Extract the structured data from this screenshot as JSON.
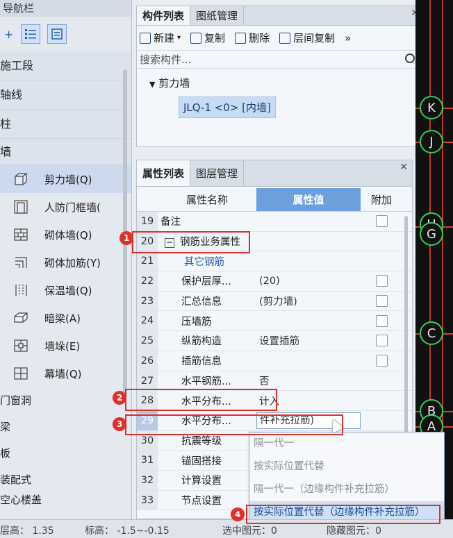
{
  "nav": {
    "title": "导航栏",
    "groups": [
      {
        "label": "施工段"
      },
      {
        "label": "轴线"
      },
      {
        "label": "柱"
      },
      {
        "label": "墙"
      }
    ],
    "items": [
      {
        "label": "剪力墙(Q)",
        "icon": "shear-wall-icon"
      },
      {
        "label": "人防门框墙(",
        "icon": "civil-defense-door-wall-icon"
      },
      {
        "label": "砌体墙(Q)",
        "icon": "masonry-wall-icon"
      },
      {
        "label": "砌体加筋(Y)",
        "icon": "masonry-rebar-icon"
      },
      {
        "label": "保温墙(Q)",
        "icon": "insulation-wall-icon"
      },
      {
        "label": "暗梁(A)",
        "icon": "hidden-beam-icon"
      },
      {
        "label": "墙垛(E)",
        "icon": "wall-pier-icon"
      },
      {
        "label": "幕墙(Q)",
        "icon": "curtain-wall-icon"
      }
    ],
    "sub_groups": [
      {
        "label": "门窗洞"
      },
      {
        "label": "梁"
      },
      {
        "label": "板"
      },
      {
        "label": "装配式"
      },
      {
        "label": "空心楼盖"
      }
    ]
  },
  "complist": {
    "tabs": [
      {
        "label": "构件列表"
      },
      {
        "label": "图纸管理"
      }
    ],
    "toolbar": {
      "new": "新建",
      "copy": "复制",
      "delete": "删除",
      "floor_copy": "层间复制",
      "more": "»"
    },
    "search_placeholder": "搜索构件...",
    "tree_node": "剪力墙",
    "tree_leaf": "JLQ-1 <0> [内墙]"
  },
  "props": {
    "tabs": [
      {
        "label": "属性列表"
      },
      {
        "label": "图层管理"
      }
    ],
    "headers": {
      "name": "属性名称",
      "value": "属性值",
      "add": "附加"
    },
    "rows": [
      {
        "num": "19",
        "name": "备注",
        "value": "",
        "cb": true
      },
      {
        "num": "20",
        "name": "钢筋业务属性",
        "value": "",
        "cb": false
      },
      {
        "num": "21",
        "name": "其它钢筋",
        "value": "",
        "cb": false
      },
      {
        "num": "22",
        "name": "保护层厚...",
        "value": "(20)",
        "cb": true
      },
      {
        "num": "23",
        "name": "汇总信息",
        "value": "(剪力墙)",
        "cb": true
      },
      {
        "num": "24",
        "name": "压墙筋",
        "value": "",
        "cb": true
      },
      {
        "num": "25",
        "name": "纵筋构造",
        "value": "设置插筋",
        "cb": true
      },
      {
        "num": "26",
        "name": "插筋信息",
        "value": "",
        "cb": true
      },
      {
        "num": "27",
        "name": "水平钢筋...",
        "value": "否",
        "cb": false
      },
      {
        "num": "28",
        "name": "水平分布...",
        "value": "计入",
        "cb": false
      },
      {
        "num": "29",
        "name": "水平分布...",
        "value": "件补充拉筋)",
        "cb": false
      },
      {
        "num": "30",
        "name": "抗震等级",
        "value": "",
        "cb": false
      },
      {
        "num": "31",
        "name": "锚固搭接",
        "value": "",
        "cb": false
      },
      {
        "num": "32",
        "name": "计算设置",
        "value": "",
        "cb": false
      },
      {
        "num": "33",
        "name": "节点设置",
        "value": "",
        "cb": false
      }
    ]
  },
  "dropdown": {
    "options": [
      "隔一代一",
      "按实际位置代替",
      "隔一代一（边缘构件补充拉筋）",
      "按实际位置代替（边缘构件补充拉筋）"
    ]
  },
  "status": {
    "floor_height": "层高：  1.35",
    "elevation": "标高：  -1.5~-0.15",
    "selected": "选中图元：0",
    "hidden": "隐藏图元：0"
  },
  "canvas": {
    "axes": [
      "K",
      "J",
      "H",
      "G",
      "C",
      "B",
      "A"
    ]
  },
  "annotations": [
    "1",
    "2",
    "3",
    "4"
  ],
  "colors": {
    "annotation_red": "#e0302a",
    "value_header_blue": "#6d9fdc",
    "grid_green": "#2fd05b",
    "grid_red": "#d93a3a"
  }
}
